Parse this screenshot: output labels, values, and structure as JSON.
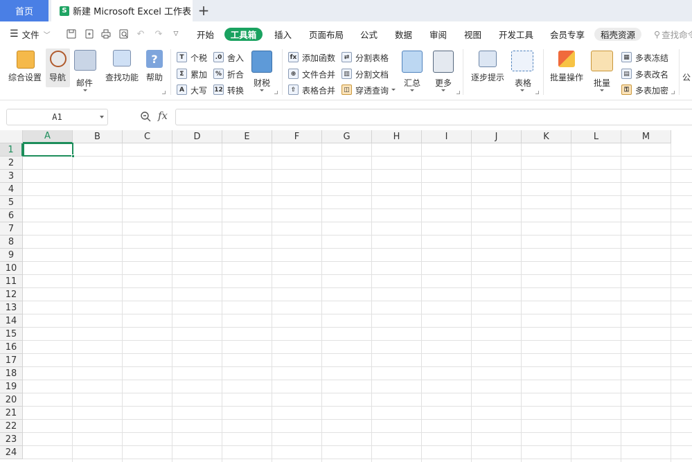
{
  "tabs": {
    "home": "首页",
    "doc_icon": "S",
    "doc_title": "新建 Microsoft Excel 工作表",
    "add": "+"
  },
  "menu": {
    "file": "文件",
    "items": [
      "开始",
      "工具箱",
      "插入",
      "页面布局",
      "公式",
      "数据",
      "审阅",
      "视图",
      "开发工具",
      "会员专享",
      "稻壳资源"
    ],
    "active": "工具箱",
    "search": "查找命令"
  },
  "ribbon": {
    "comprehensive_settings": "综合设置",
    "navigation": "导航",
    "mail": "邮件",
    "find_function": "查找功能",
    "help": "帮助",
    "help_icon": "?",
    "tax": "个税",
    "accumulate": "累加",
    "uppercase": "大写",
    "rounding": "舍入",
    "discount": "折合",
    "convert": "转换",
    "finance_tax": "财税",
    "add_function": "添加函数",
    "file_merge": "文件合并",
    "table_merge": "表格合并",
    "split_table": "分割表格",
    "split_doc": "分割文档",
    "penetrate_query": "穿透查询",
    "summary": "汇总",
    "more": "更多",
    "step_hint": "逐步提示",
    "table": "表格",
    "batch_operation": "批量操作",
    "batch": "批量",
    "multi_freeze": "多表冻结",
    "multi_rename": "多表改名",
    "multi_encrypt": "多表加密",
    "formula_partial": "公"
  },
  "formula_bar": {
    "cell_ref": "A1",
    "fx": "fx",
    "value": ""
  },
  "grid": {
    "columns": [
      "A",
      "B",
      "C",
      "D",
      "E",
      "F",
      "G",
      "H",
      "I",
      "J",
      "K",
      "L",
      "M"
    ],
    "rows": [
      "1",
      "2",
      "3",
      "4",
      "5",
      "6",
      "7",
      "8",
      "9",
      "10",
      "11",
      "12",
      "13",
      "14",
      "15",
      "16",
      "17",
      "18",
      "19",
      "20",
      "21",
      "22",
      "23",
      "24"
    ],
    "selected_cell": "A1"
  },
  "colors": {
    "accent": "#1d8e5b",
    "home_tab": "#4a7fe5",
    "active_pill": "#1aa260"
  }
}
